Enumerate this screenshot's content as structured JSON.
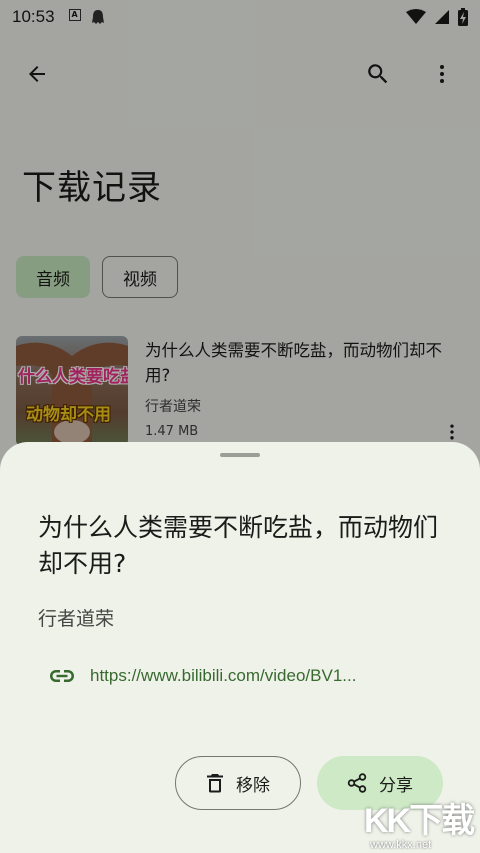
{
  "status_bar": {
    "time": "10:53",
    "notif_a_label": "A"
  },
  "app_bar": {
    "back_icon": "arrow-left-icon",
    "search_icon": "search-icon",
    "more_icon": "more-vert-icon"
  },
  "page": {
    "title": "下载记录",
    "chips": [
      {
        "label": "音频",
        "selected": true
      },
      {
        "label": "视频",
        "selected": false
      }
    ]
  },
  "list": {
    "items": [
      {
        "title": "为什么人类需要不断吃盐，而动物们却不用?",
        "author": "行者道荣",
        "size": "1.47 MB",
        "thumb_text_1": "什么人类要吃盐",
        "thumb_text_2": "动物却不用"
      }
    ]
  },
  "sheet": {
    "title": "为什么人类需要不断吃盐，而动物们却不用?",
    "author": "行者道荣",
    "link": "https://www.bilibili.com/video/BV1...",
    "remove_label": "移除",
    "share_label": "分享"
  },
  "watermark": {
    "main": "KK下载",
    "url": "www.kkx.net"
  },
  "colors": {
    "accent": "#386a30",
    "chip_selected": "#c7e8c0",
    "share_bg": "#cde9c5",
    "sheet_bg": "#eff2e9"
  }
}
